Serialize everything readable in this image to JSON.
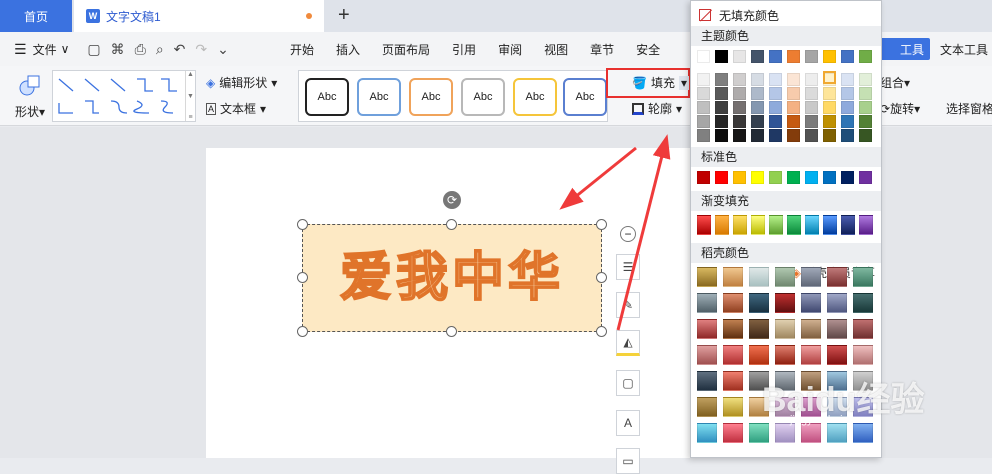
{
  "tabs": {
    "home": "首页",
    "doc": "文字文稿1"
  },
  "menu": {
    "file": "文件",
    "items": [
      "开始",
      "插入",
      "页面布局",
      "引用",
      "审阅",
      "视图",
      "章节",
      "安全"
    ],
    "draw_tool": "工具",
    "text_tool": "文本工具"
  },
  "ribbon": {
    "shape": "形状",
    "edit_shape": "编辑形状",
    "textbox": "文本框",
    "styles": [
      "Abc",
      "Abc",
      "Abc",
      "Abc",
      "Abc",
      "Abc"
    ],
    "fill": "填充",
    "outline": "轮廓",
    "combine": "组合",
    "rotate": "旋转",
    "select_pane": "选择窗格"
  },
  "doc": {
    "art_text": "爱我中华"
  },
  "panel": {
    "no_fill": "无填充颜色",
    "theme_colors": "主题颜色",
    "standard_colors": "标准色",
    "gradient_fill": "渐变填充",
    "daoke_colors": "稻壳颜色",
    "vip_only": "稻壳会员专享"
  },
  "watermark": {
    "main": "Baidu经验",
    "sub": "jingyan.baidu.com"
  },
  "colors": {
    "accent": "#3b72e0",
    "highlight": "#e8312f",
    "text_fill": "#fde9c4",
    "text_stroke": "#e0742a"
  }
}
